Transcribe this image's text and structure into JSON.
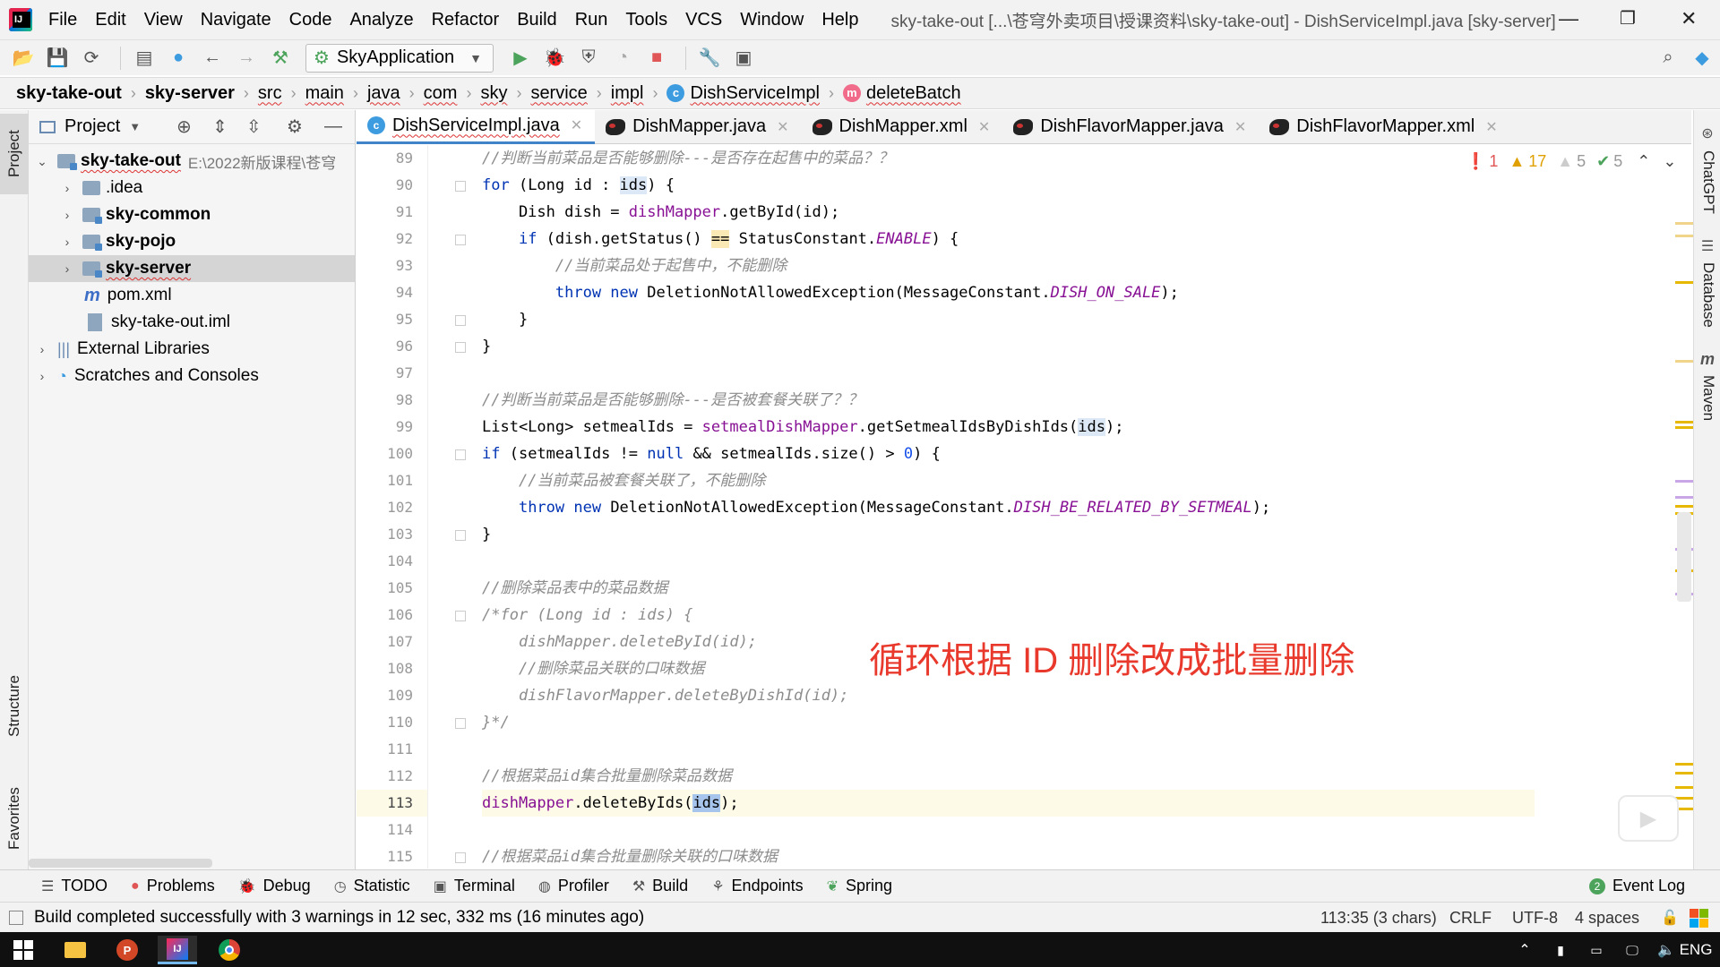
{
  "menubar": {
    "items": [
      "File",
      "Edit",
      "View",
      "Navigate",
      "Code",
      "Analyze",
      "Refactor",
      "Build",
      "Run",
      "Tools",
      "VCS",
      "Window",
      "Help"
    ],
    "window_title": "sky-take-out [...\\苍穹外卖项目\\授课资料\\sky-take-out] - DishServiceImpl.java [sky-server]"
  },
  "toolbar": {
    "run_config": "SkyApplication"
  },
  "breadcrumb": [
    "sky-take-out",
    "sky-server",
    "src",
    "main",
    "java",
    "com",
    "sky",
    "service",
    "impl",
    "DishServiceImpl",
    "deleteBatch"
  ],
  "left_strip": {
    "project": "Project",
    "structure": "Structure",
    "favorites": "Favorites"
  },
  "project_panel": {
    "title": "Project",
    "tree": [
      {
        "label": "sky-take-out",
        "path": "E:\\2022新版课程\\苍穹"
      },
      {
        "label": ".idea"
      },
      {
        "label": "sky-common"
      },
      {
        "label": "sky-pojo"
      },
      {
        "label": "sky-server"
      },
      {
        "label": "pom.xml"
      },
      {
        "label": "sky-take-out.iml"
      },
      {
        "label": "External Libraries"
      },
      {
        "label": "Scratches and Consoles"
      }
    ]
  },
  "tabs": [
    "DishServiceImpl.java",
    "DishMapper.java",
    "DishMapper.xml",
    "DishFlavorMapper.java",
    "DishFlavorMapper.xml"
  ],
  "inspections": {
    "errors": "1",
    "warnings": "17",
    "weak": "5",
    "ok": "5"
  },
  "line_numbers": [
    "89",
    "90",
    "91",
    "92",
    "93",
    "94",
    "95",
    "96",
    "97",
    "98",
    "99",
    "100",
    "101",
    "102",
    "103",
    "104",
    "105",
    "106",
    "107",
    "108",
    "109",
    "110",
    "111",
    "112",
    "113",
    "114",
    "115"
  ],
  "code": {
    "l89": "//判断当前菜品是否能够删除---是否存在起售中的菜品？？",
    "l93": "//当前菜品处于起售中，不能删除",
    "l98": "//判断当前菜品是否能够删除---是否被套餐关联了？？",
    "l101": "//当前菜品被套餐关联了，不能删除",
    "l105": "//删除菜品表中的菜品数据",
    "l106": "/*for (Long id : ids) {",
    "l107": "    dishMapper.deleteById(id);",
    "l108": "    //删除菜品关联的口味数据",
    "l109": "    dishFlavorMapper.deleteByDishId(id);",
    "l110": "}*/",
    "l112": "//根据菜品id集合批量删除菜品数据",
    "l115": "//根据菜品id集合批量删除关联的口味数据"
  },
  "overlay_annotation": "循环根据 ID 删除改成批量删除",
  "right_strip": {
    "chatgpt": "ChatGPT",
    "database": "Database",
    "maven": "Maven"
  },
  "bottom_tabs": [
    "TODO",
    "Problems",
    "Debug",
    "Statistic",
    "Terminal",
    "Profiler",
    "Build",
    "Endpoints",
    "Spring"
  ],
  "event_log": "Event Log",
  "event_log_count": "2",
  "status": {
    "message": "Build completed successfully with 3 warnings in 12 sec, 332 ms (16 minutes ago)",
    "position": "113:35 (3 chars)",
    "line_sep": "CRLF",
    "encoding": "UTF-8",
    "indent": "4 spaces"
  },
  "taskbar": {
    "lang": "ENG"
  }
}
